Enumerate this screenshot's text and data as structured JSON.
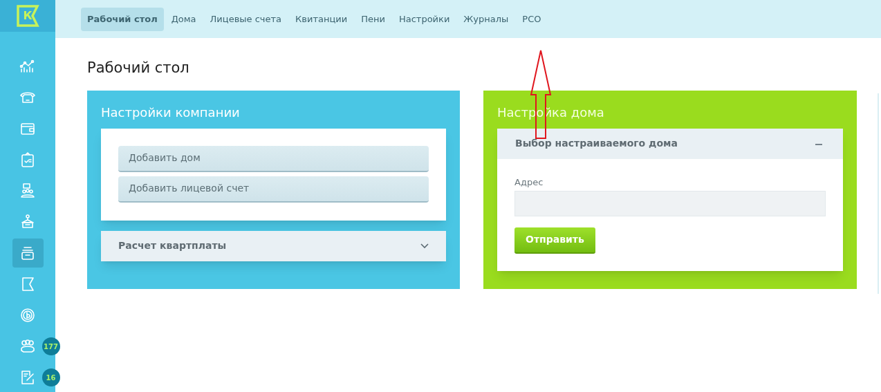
{
  "logo": {
    "letter": "К"
  },
  "nav": [
    {
      "label": "Рабочий стол",
      "selected": true
    },
    {
      "label": "Дома",
      "selected": false
    },
    {
      "label": "Лицевые счета",
      "selected": false
    },
    {
      "label": "Квитанции",
      "selected": false
    },
    {
      "label": "Пени",
      "selected": false
    },
    {
      "label": "Настройки",
      "selected": false
    },
    {
      "label": "Журналы",
      "selected": false
    },
    {
      "label": "РСО",
      "selected": false
    }
  ],
  "sidebar": {
    "items": [
      {
        "selected": false
      },
      {
        "selected": false
      },
      {
        "selected": false
      },
      {
        "selected": false
      },
      {
        "selected": false
      },
      {
        "selected": false
      },
      {
        "selected": true
      },
      {
        "selected": false
      },
      {
        "selected": false
      },
      {
        "selected": false,
        "badge": "177"
      },
      {
        "selected": false,
        "badge": "16"
      }
    ]
  },
  "page_title": "Рабочий стол",
  "company_card": {
    "title": "Настройки компании",
    "buttons": [
      "Добавить дом",
      "Добавить лицевой счет"
    ],
    "accordion": {
      "title": "Расчет квартплаты",
      "expanded": false
    }
  },
  "house_card": {
    "title": "Настройка дома",
    "panel": {
      "title": "Выбор настраиваемого дома",
      "expanded": true,
      "field_label": "Адрес",
      "submit": "Отправить"
    }
  },
  "annotation": {
    "kind": "arrow"
  }
}
